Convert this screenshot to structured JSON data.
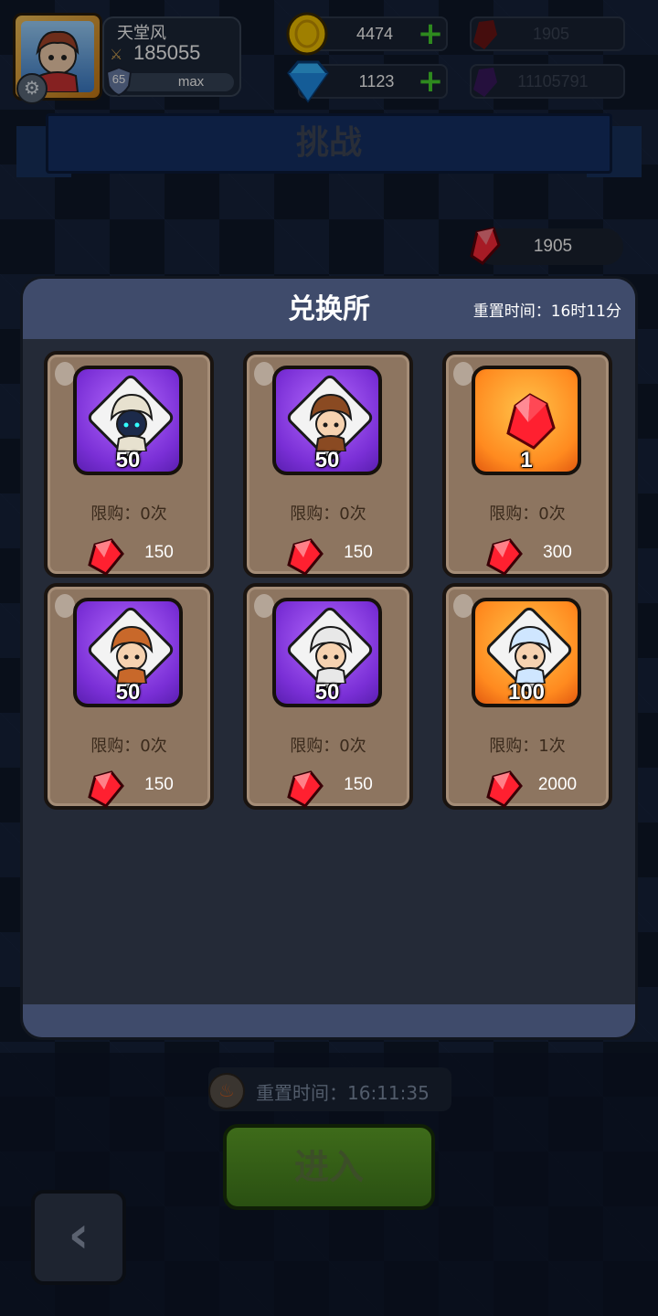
{
  "player": {
    "name": "天堂风",
    "power": "185055",
    "level": "65",
    "exp_label": "max"
  },
  "resources": {
    "gold": "4474",
    "diamonds": "1123",
    "red_crystal": "1905",
    "purple_crystal": "11105791"
  },
  "title": "挑战",
  "crystal_balance": "1905",
  "shop": {
    "title": "兑换所",
    "reset_label": "重置时间：16时11分",
    "items": [
      {
        "qty": "50",
        "bg": "purple",
        "icon": "dark-mage-hero-icon",
        "limit": "限购：0次",
        "price": "150"
      },
      {
        "qty": "50",
        "bg": "purple",
        "icon": "old-sage-hero-icon",
        "limit": "限购：0次",
        "price": "150"
      },
      {
        "qty": "1",
        "bg": "orange",
        "icon": "red-crystal-icon",
        "limit": "限购：0次",
        "price": "300"
      },
      {
        "qty": "50",
        "bg": "purple",
        "icon": "monkey-king-hero-icon",
        "limit": "限购：0次",
        "price": "150"
      },
      {
        "qty": "50",
        "bg": "purple",
        "icon": "white-hair-warrior-hero-icon",
        "limit": "限购：0次",
        "price": "150"
      },
      {
        "qty": "100",
        "bg": "orange",
        "icon": "ice-maiden-hero-icon",
        "limit": "限购：1次",
        "price": "2000"
      }
    ]
  },
  "reset_timer": "重置时间：16:11:35",
  "enter_label": "进入",
  "colors": {
    "gold": "#f5c400",
    "plus": "#47d42e",
    "panel_head": "#3f4b6b",
    "card": "#8d7560"
  }
}
